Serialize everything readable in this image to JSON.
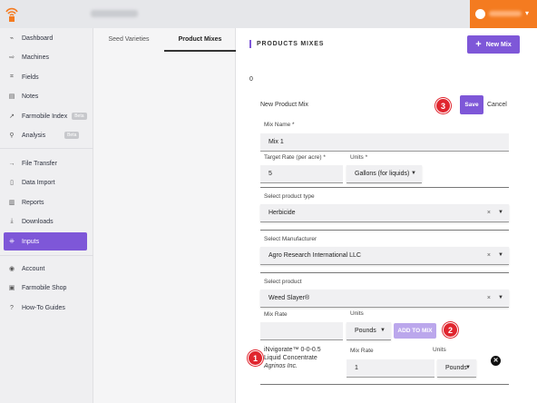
{
  "app": {
    "accent_color": "#7e57d8",
    "user_color": "#f47b20"
  },
  "sidebar": {
    "items": [
      {
        "label": "Dashboard",
        "icon": "dashboard-icon"
      },
      {
        "label": "Machines",
        "icon": "machines-icon"
      },
      {
        "label": "Fields",
        "icon": "fields-icon"
      },
      {
        "label": "Notes",
        "icon": "notes-icon"
      },
      {
        "label": "Farmobile Index",
        "icon": "index-icon",
        "badge": "Beta"
      },
      {
        "label": "Analysis",
        "icon": "analysis-icon",
        "badge": "Beta"
      },
      {
        "label": "File Transfer",
        "icon": "file-transfer-icon"
      },
      {
        "label": "Data Import",
        "icon": "data-import-icon"
      },
      {
        "label": "Reports",
        "icon": "reports-icon"
      },
      {
        "label": "Downloads",
        "icon": "downloads-icon"
      },
      {
        "label": "Inputs",
        "icon": "inputs-icon",
        "active": true
      },
      {
        "label": "Account",
        "icon": "account-icon"
      },
      {
        "label": "Farmobile Shop",
        "icon": "shop-icon"
      },
      {
        "label": "How-To Guides",
        "icon": "help-icon"
      }
    ]
  },
  "tabs": {
    "seed_varieties": "Seed Varieties",
    "product_mixes": "Product Mixes"
  },
  "main": {
    "title": "PRODUCTS MIXES",
    "new_mix_label": "New Mix",
    "count": "0",
    "new_product_mix_label": "New Product Mix",
    "save_label": "Save",
    "cancel_label": "Cancel"
  },
  "form": {
    "mix_name_label": "Mix Name *",
    "mix_name_value": "Mix 1",
    "target_rate_label": "Target Rate (per acre) *",
    "target_rate_value": "5",
    "units_label": "Units *",
    "units_value": "Gallons (for liquids)",
    "product_type_label": "Select product type",
    "product_type_value": "Herbicide",
    "manufacturer_label": "Select Manufacturer",
    "manufacturer_value": "Agro Research International LLC",
    "product_label": "Select product",
    "product_value": "Weed Slayer®",
    "mix_rate_label": "Mix Rate",
    "mix_rate_value": "",
    "mix_units_label": "Units",
    "mix_units_value": "Pounds",
    "add_to_mix_label": "ADD TO MIX"
  },
  "mix_item": {
    "name": "iNvigorate™ 0-0-0.5 Liquid Concentrate",
    "manufacturer": "Agrinos Inc.",
    "rate_label": "Mix Rate",
    "rate_value": "1",
    "units_label": "Units",
    "units_value": "Pounds"
  },
  "annotations": [
    "1",
    "2",
    "3"
  ]
}
